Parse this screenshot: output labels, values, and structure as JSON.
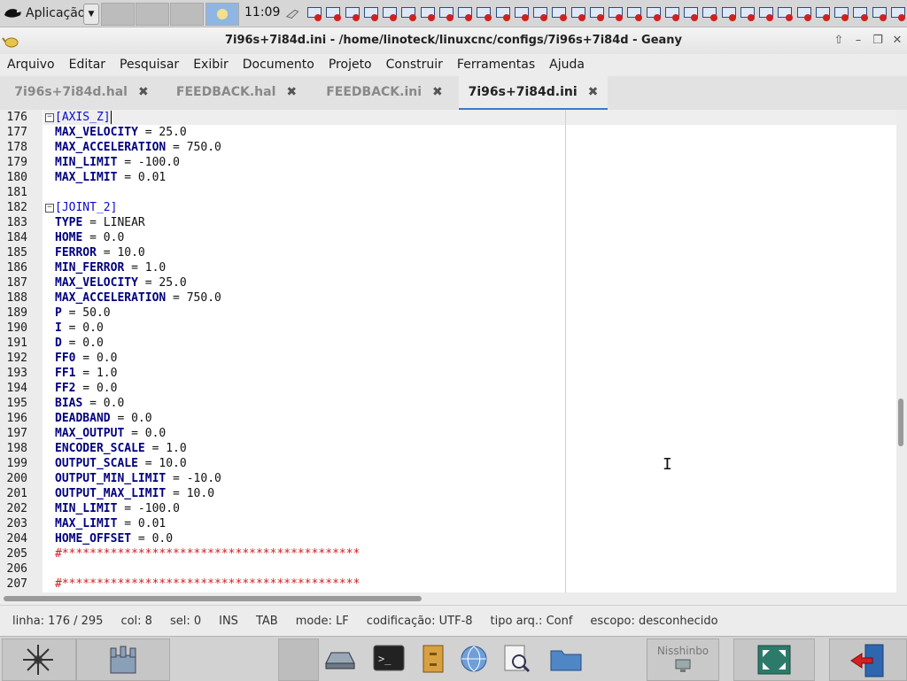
{
  "top_panel": {
    "app_menu_label": "Aplicação",
    "clock": "11:09",
    "workspace_count": 4,
    "tray_icon_count": 32
  },
  "window": {
    "title": "7i96s+7i84d.ini - /home/linoteck/linuxcnc/configs/7i96s+7i84d - Geany"
  },
  "menubar": [
    "Arquivo",
    "Editar",
    "Pesquisar",
    "Exibir",
    "Documento",
    "Projeto",
    "Construir",
    "Ferramentas",
    "Ajuda"
  ],
  "tabs": [
    {
      "label": "7i96s+7i84d.hal",
      "active": false
    },
    {
      "label": "FEEDBACK.hal",
      "active": false
    },
    {
      "label": "FEEDBACK.ini",
      "active": false
    },
    {
      "label": "7i96s+7i84d.ini",
      "active": true
    }
  ],
  "editor": {
    "lines": [
      {
        "n": "176",
        "fold": true,
        "section": "[AXIS_Z]"
      },
      {
        "n": "177",
        "key": "MAX_VELOCITY",
        "val": " = 25.0"
      },
      {
        "n": "178",
        "key": "MAX_ACCELERATION",
        "val": " = 750.0"
      },
      {
        "n": "179",
        "key": "MIN_LIMIT",
        "val": " = -100.0"
      },
      {
        "n": "180",
        "key": "MAX_LIMIT",
        "val": " = 0.01"
      },
      {
        "n": "181"
      },
      {
        "n": "182",
        "fold": true,
        "section": "[JOINT_2]"
      },
      {
        "n": "183",
        "key": "TYPE",
        "val": " = LINEAR"
      },
      {
        "n": "184",
        "key": "HOME",
        "val": " = 0.0"
      },
      {
        "n": "185",
        "key": "FERROR",
        "val": " = 10.0"
      },
      {
        "n": "186",
        "key": "MIN_FERROR",
        "val": " = 1.0"
      },
      {
        "n": "187",
        "key": "MAX_VELOCITY",
        "val": " = 25.0"
      },
      {
        "n": "188",
        "key": "MAX_ACCELERATION",
        "val": " = 750.0"
      },
      {
        "n": "189",
        "key": "P",
        "val": " = 50.0"
      },
      {
        "n": "190",
        "key": "I",
        "val": " = 0.0"
      },
      {
        "n": "191",
        "key": "D",
        "val": " = 0.0"
      },
      {
        "n": "192",
        "key": "FF0",
        "val": " = 0.0"
      },
      {
        "n": "193",
        "key": "FF1",
        "val": " = 1.0"
      },
      {
        "n": "194",
        "key": "FF2",
        "val": " = 0.0"
      },
      {
        "n": "195",
        "key": "BIAS",
        "val": " = 0.0"
      },
      {
        "n": "196",
        "key": "DEADBAND",
        "val": " = 0.0"
      },
      {
        "n": "197",
        "key": "MAX_OUTPUT",
        "val": " = 0.0"
      },
      {
        "n": "198",
        "key": "ENCODER_SCALE",
        "val": " = 1.0"
      },
      {
        "n": "199",
        "key": "OUTPUT_SCALE",
        "val": " = 10.0"
      },
      {
        "n": "200",
        "key": "OUTPUT_MIN_LIMIT",
        "val": " = -10.0"
      },
      {
        "n": "201",
        "key": "OUTPUT_MAX_LIMIT",
        "val": " = 10.0"
      },
      {
        "n": "202",
        "key": "MIN_LIMIT",
        "val": " = -100.0"
      },
      {
        "n": "203",
        "key": "MAX_LIMIT",
        "val": " = 0.01"
      },
      {
        "n": "204",
        "key": "HOME_OFFSET",
        "val": " = 0.0"
      },
      {
        "n": "205",
        "comment": "#*******************************************"
      },
      {
        "n": "206"
      },
      {
        "n": "207",
        "comment": "#*******************************************"
      }
    ]
  },
  "statusbar": {
    "line": "linha: 176 / 295",
    "col": "col: 8",
    "sel": "sel: 0",
    "ins": "INS",
    "tab": "TAB",
    "mode": "mode: LF",
    "encoding": "codificação: UTF-8",
    "filetype": "tipo arq.: Conf",
    "scope": "escopo: desconhecido"
  },
  "taskbar": {
    "nisshinbo_label": "Nisshinbo"
  },
  "colors": {
    "key": "#000080",
    "section": "#0b0bd0",
    "comment": "#d21a1a",
    "active_tab_underline": "#3a78c9"
  }
}
